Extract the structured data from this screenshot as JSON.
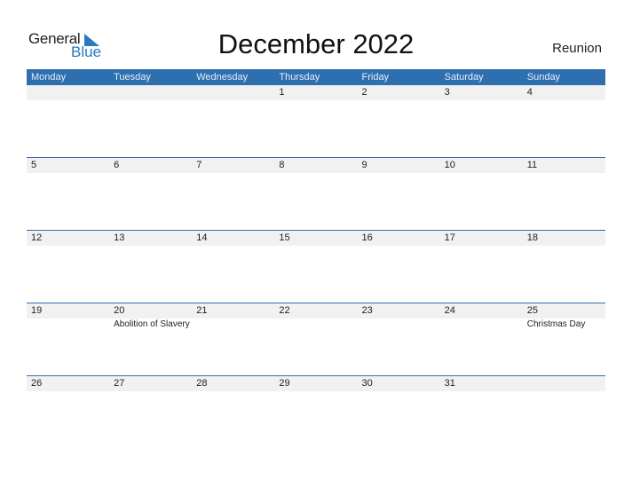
{
  "logo": {
    "general": "General",
    "blue": "Blue"
  },
  "title": "December 2022",
  "country": "Reunion",
  "colors": {
    "header_bg": "#2e6fb0",
    "strip_bg": "#f1f1f1",
    "logo_blue": "#2a78c0"
  },
  "weekdays": [
    "Monday",
    "Tuesday",
    "Wednesday",
    "Thursday",
    "Friday",
    "Saturday",
    "Sunday"
  ],
  "weeks": [
    {
      "days": [
        "",
        "",
        "",
        "1",
        "2",
        "3",
        "4"
      ],
      "events": [
        "",
        "",
        "",
        "",
        "",
        "",
        ""
      ]
    },
    {
      "days": [
        "5",
        "6",
        "7",
        "8",
        "9",
        "10",
        "11"
      ],
      "events": [
        "",
        "",
        "",
        "",
        "",
        "",
        ""
      ]
    },
    {
      "days": [
        "12",
        "13",
        "14",
        "15",
        "16",
        "17",
        "18"
      ],
      "events": [
        "",
        "",
        "",
        "",
        "",
        "",
        ""
      ]
    },
    {
      "days": [
        "19",
        "20",
        "21",
        "22",
        "23",
        "24",
        "25"
      ],
      "events": [
        "",
        "Abolition of Slavery",
        "",
        "",
        "",
        "",
        "Christmas Day"
      ]
    },
    {
      "days": [
        "26",
        "27",
        "28",
        "29",
        "30",
        "31",
        ""
      ],
      "events": [
        "",
        "",
        "",
        "",
        "",
        "",
        ""
      ]
    }
  ]
}
